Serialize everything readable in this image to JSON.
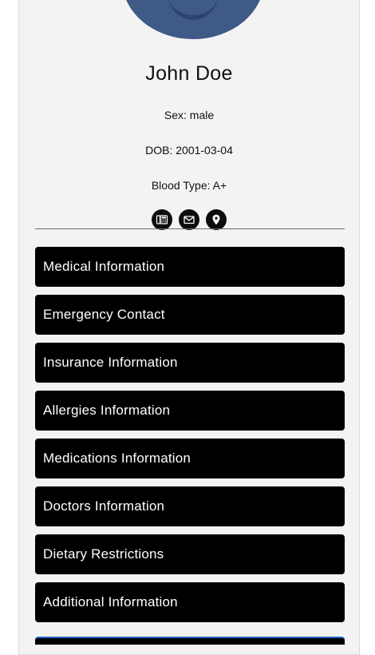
{
  "profile": {
    "name": "John Doe",
    "sex": "Sex: male",
    "dob": "DOB: 2001-03-04",
    "blood_type": "Blood Type: A+"
  },
  "contact_icons": [
    {
      "icon": "phone-icon"
    },
    {
      "icon": "mail-icon"
    },
    {
      "icon": "location-pin-icon"
    }
  ],
  "sections": [
    {
      "label": "Medical Information"
    },
    {
      "label": "Emergency Contact"
    },
    {
      "label": "Insurance Information"
    },
    {
      "label": "Allergies Information"
    },
    {
      "label": "Medications Information"
    },
    {
      "label": "Doctors Information"
    },
    {
      "label": "Dietary Restrictions"
    },
    {
      "label": "Additional Information"
    }
  ],
  "colors": {
    "card_bg": "#f3f3f3",
    "section_bg": "#000000",
    "section_text": "#ffffff",
    "accent": "#1f5fbf"
  }
}
